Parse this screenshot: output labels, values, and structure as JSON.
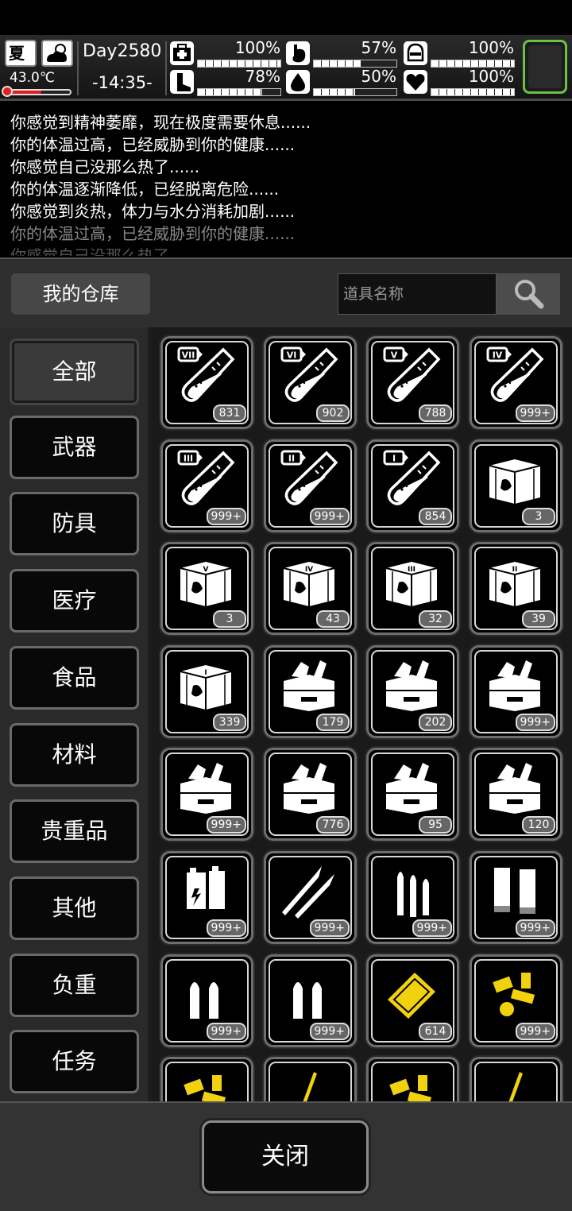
{
  "status": {
    "season": "夏",
    "temperature": "43.0℃",
    "temperature_level": 0.55,
    "day": "Day2580",
    "time": "-14:35-",
    "stats": [
      {
        "icon": "medkit-icon",
        "value": "100%",
        "level": 1.0
      },
      {
        "icon": "stomach-icon",
        "value": "57%",
        "level": 0.57
      },
      {
        "icon": "helmet-icon",
        "value": "100%",
        "level": 1.0
      },
      {
        "icon": "boot-icon",
        "value": "78%",
        "level": 0.78
      },
      {
        "icon": "water-drop-icon",
        "value": "50%",
        "level": 0.5
      },
      {
        "icon": "heart-icon",
        "value": "100%",
        "level": 1.0
      }
    ]
  },
  "log": [
    "你感觉到精神萎靡，现在极度需要休息......",
    "你的体温过高，已经威胁到你的健康......",
    "你感觉自己没那么热了......",
    "你的体温逐渐降低，已经脱离危险......",
    "你感觉到炎热，体力与水分消耗加剧......",
    "你的体温过高，已经威胁到你的健康......",
    "你感觉自己没那么热了......"
  ],
  "warehouse": {
    "title": "我的仓库",
    "search_placeholder": "道具名称",
    "categories": [
      "全部",
      "武器",
      "防具",
      "医疗",
      "食品",
      "材料",
      "贵重品",
      "其他",
      "负重",
      "任务"
    ],
    "items": [
      {
        "icon": "test-tube-vii-icon",
        "label": "VII",
        "count": "831"
      },
      {
        "icon": "test-tube-vi-icon",
        "label": "VI",
        "count": "902"
      },
      {
        "icon": "test-tube-v-icon",
        "label": "V",
        "count": "788"
      },
      {
        "icon": "test-tube-iv-icon",
        "label": "IV",
        "count": "999+"
      },
      {
        "icon": "test-tube-iii-icon",
        "label": "III",
        "count": "999+"
      },
      {
        "icon": "test-tube-ii-icon",
        "label": "II",
        "count": "999+"
      },
      {
        "icon": "test-tube-i-icon",
        "label": "I",
        "count": "854"
      },
      {
        "icon": "gold-chest-icon",
        "label": "",
        "count": "3"
      },
      {
        "icon": "crate-v-icon",
        "label": "V",
        "count": "3"
      },
      {
        "icon": "crate-iv-icon",
        "label": "IV",
        "count": "43"
      },
      {
        "icon": "crate-iii-icon",
        "label": "III",
        "count": "32"
      },
      {
        "icon": "crate-ii-icon",
        "label": "II",
        "count": "39"
      },
      {
        "icon": "crate-i-icon",
        "label": "I",
        "count": "339"
      },
      {
        "icon": "toolbox-icon",
        "label": "",
        "count": "179"
      },
      {
        "icon": "tool-case-icon",
        "label": "",
        "count": "202"
      },
      {
        "icon": "tool-bag-icon",
        "label": "",
        "count": "999+"
      },
      {
        "icon": "repair-kit-icon",
        "label": "",
        "count": "999+"
      },
      {
        "icon": "tool-pouch-icon",
        "label": "",
        "count": "776"
      },
      {
        "icon": "car-toolbox-icon",
        "label": "",
        "count": "95"
      },
      {
        "icon": "car-toolbox-2-icon",
        "label": "",
        "count": "120"
      },
      {
        "icon": "battery-icon",
        "label": "",
        "count": "999+"
      },
      {
        "icon": "rifle-bullet-icon",
        "label": "",
        "count": "999+"
      },
      {
        "icon": "bullets-icon",
        "label": "",
        "count": "999+"
      },
      {
        "icon": "shotgun-shell-icon",
        "label": "",
        "count": "999+"
      },
      {
        "icon": "pistol-bullet-icon",
        "label": "",
        "count": "999+"
      },
      {
        "icon": "pistol-bullets-icon",
        "label": "",
        "count": "999+"
      },
      {
        "icon": "gold-plate-icon",
        "label": "",
        "count": "614"
      },
      {
        "icon": "gold-parts-icon",
        "label": "",
        "count": "999+"
      },
      {
        "icon": "gold-shells-icon",
        "label": "",
        "count": ""
      },
      {
        "icon": "drill-icon",
        "label": "",
        "count": ""
      },
      {
        "icon": "gold-bars-icon",
        "label": "",
        "count": ""
      },
      {
        "icon": "rod-icon",
        "label": "",
        "count": ""
      }
    ],
    "close_label": "关闭"
  },
  "colors": {
    "accent_green": "#6cc04a",
    "temp_red": "#e02020",
    "gold": "#f2d20e"
  }
}
